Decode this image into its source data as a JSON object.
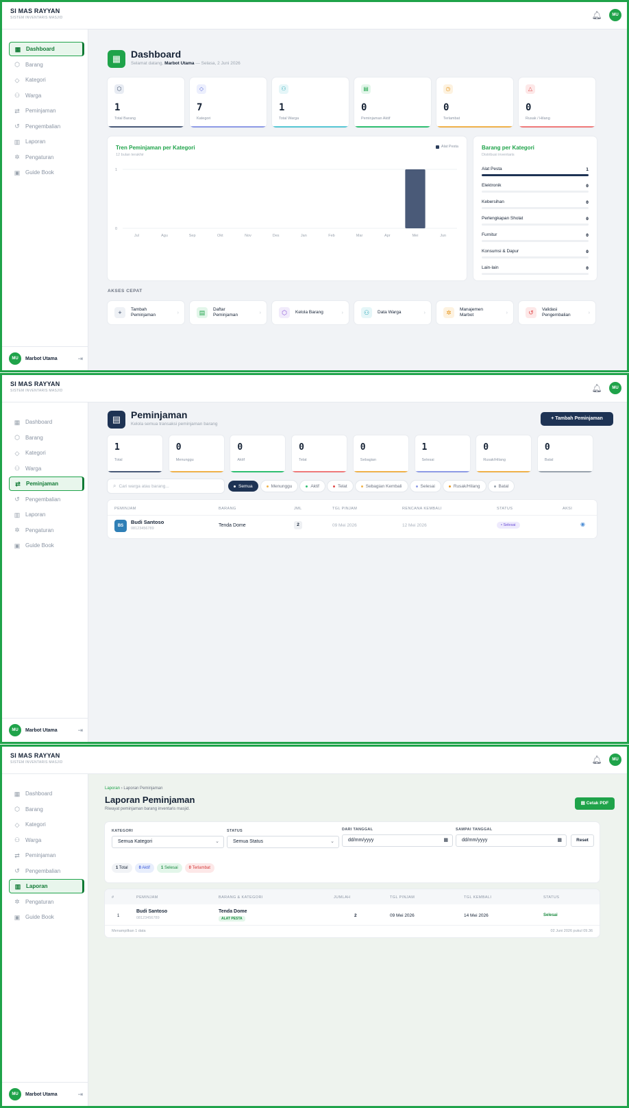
{
  "app": {
    "title": "SI MAS RAYYAN",
    "subtitle": "SISTEM INVENTARIS MASJID",
    "user_initials": "MU",
    "user_name": "Marbot Utama"
  },
  "sidebar": {
    "items": [
      {
        "label": "Dashboard",
        "icon": "grid-icon"
      },
      {
        "label": "Barang",
        "icon": "box-icon"
      },
      {
        "label": "Kategori",
        "icon": "tag-icon"
      },
      {
        "label": "Warga",
        "icon": "users-icon"
      },
      {
        "label": "Peminjaman",
        "icon": "swap-icon"
      },
      {
        "label": "Pengembalian",
        "icon": "undo-icon"
      },
      {
        "label": "Laporan",
        "icon": "chart-icon"
      },
      {
        "label": "Pengaturan",
        "icon": "gear-icon"
      },
      {
        "label": "Guide Book",
        "icon": "book-icon"
      }
    ]
  },
  "dashboard": {
    "title": "Dashboard",
    "greeting_prefix": "Selamat datang,",
    "greeting_name": "Marbot Utama",
    "greeting_suffix": "— Selasa, 2 Juni 2026",
    "stats": [
      {
        "value": "1",
        "label": "Total Barang",
        "color": "#4a5a78",
        "icon_bg": "#e8ecf3",
        "icon_color": "#2c3e5c"
      },
      {
        "value": "7",
        "label": "Kategori",
        "color": "#8e9be6",
        "icon_bg": "#eceffd",
        "icon_color": "#5a6bd8"
      },
      {
        "value": "1",
        "label": "Total Warga",
        "color": "#57c7d4",
        "icon_bg": "#e5f6f8",
        "icon_color": "#2fa9b8"
      },
      {
        "value": "0",
        "label": "Peminjaman Aktif",
        "color": "#2fbf71",
        "icon_bg": "#e3f6ea",
        "icon_color": "#1fa34a"
      },
      {
        "value": "0",
        "label": "Terlambat",
        "color": "#f0b24a",
        "icon_bg": "#fdf2e0",
        "icon_color": "#e7961d"
      },
      {
        "value": "0",
        "label": "Rusak / Hilang",
        "color": "#f07a7a",
        "icon_bg": "#fde8e8",
        "icon_color": "#e04a4a"
      }
    ],
    "trend_title": "Tren Peminjaman per Kategori",
    "trend_sub": "12 bulan terakhir",
    "category_title": "Barang per Kategori",
    "category_sub": "Distribusi inventaris",
    "categories": [
      {
        "name": "Alat Pesta",
        "value": "1",
        "fill": 1
      },
      {
        "name": "Elektronik",
        "value": "0",
        "fill": 0
      },
      {
        "name": "Kebersihan",
        "value": "0",
        "fill": 0
      },
      {
        "name": "Perlengkapan Sholat",
        "value": "0",
        "fill": 0
      },
      {
        "name": "Furnitur",
        "value": "0",
        "fill": 0
      },
      {
        "name": "Konsumsi & Dapur",
        "value": "0",
        "fill": 0
      },
      {
        "name": "Lain-lain",
        "value": "0",
        "fill": 0
      }
    ],
    "quick_title": "AKSES CEPAT",
    "quick": [
      {
        "line1": "Tambah",
        "line2": "Peminjaman",
        "icon": "plus-icon",
        "bg": "#eef1f5",
        "fg": "#2c3e5c",
        "glyph": "+"
      },
      {
        "line1": "Daftar",
        "line2": "Peminjaman",
        "icon": "clipboard-icon",
        "bg": "#e3f6ea",
        "fg": "#1fa34a",
        "glyph": "▤"
      },
      {
        "line1": "Kelola Barang",
        "line2": "",
        "icon": "box-icon",
        "bg": "#f1ebfb",
        "fg": "#8a56d8",
        "glyph": "⬡"
      },
      {
        "line1": "Data Warga",
        "line2": "",
        "icon": "users-icon",
        "bg": "#e5f6f8",
        "fg": "#2fa9b8",
        "glyph": "⚇"
      },
      {
        "line1": "Manajemen",
        "line2": "Marbot",
        "icon": "gear-icon",
        "bg": "#fdf2e0",
        "fg": "#e7961d",
        "glyph": "✲"
      },
      {
        "line1": "Validasi",
        "line2": "Pengembalian",
        "icon": "undo-icon",
        "bg": "#fde8e8",
        "fg": "#e04a4a",
        "glyph": "↺"
      }
    ]
  },
  "chart_data": {
    "type": "bar",
    "title": "Tren Peminjaman per Kategori",
    "subtitle": "12 bulan terakhir",
    "categories": [
      "Jul",
      "Agu",
      "Sep",
      "Okt",
      "Nov",
      "Des",
      "Jan",
      "Feb",
      "Mar",
      "Apr",
      "Mei",
      "Jun"
    ],
    "series": [
      {
        "name": "Alat Pesta",
        "values": [
          0,
          0,
          0,
          0,
          0,
          0,
          0,
          0,
          0,
          0,
          1,
          0
        ],
        "color": "#4a5a78"
      }
    ],
    "yticks": [
      "0",
      "1"
    ],
    "ylim": [
      0,
      1
    ],
    "legend": "top-right"
  },
  "peminjaman": {
    "title": "Peminjaman",
    "subtitle": "Kelola semua transaksi peminjaman barang",
    "add_button": "+  Tambah Peminjaman",
    "stats": [
      {
        "value": "1",
        "label": "Total",
        "color": "#4a5a78"
      },
      {
        "value": "0",
        "label": "Menunggu",
        "color": "#f0b24a"
      },
      {
        "value": "0",
        "label": "Aktif",
        "color": "#2fbf71"
      },
      {
        "value": "0",
        "label": "Telat",
        "color": "#f07a7a"
      },
      {
        "value": "0",
        "label": "Sebagian",
        "color": "#f0b24a"
      },
      {
        "value": "1",
        "label": "Selesai",
        "color": "#8e9be6"
      },
      {
        "value": "0",
        "label": "Rusak/Hilang",
        "color": "#f0b24a"
      },
      {
        "value": "0",
        "label": "Batal",
        "color": "#9aa3ae"
      }
    ],
    "search_placeholder": "Cari warga atau barang...",
    "filters": [
      {
        "label": "Semua",
        "dot": "#ffffff"
      },
      {
        "label": "Menunggu",
        "dot": "#f0b24a"
      },
      {
        "label": "Aktif",
        "dot": "#2fbf71"
      },
      {
        "label": "Telat",
        "dot": "#e04a4a"
      },
      {
        "label": "Sebagian Kembali",
        "dot": "#f0b24a"
      },
      {
        "label": "Selesai",
        "dot": "#8e9be6"
      },
      {
        "label": "Rusak/Hilang",
        "dot": "#e7961d"
      },
      {
        "label": "Batal",
        "dot": "#9aa3ae"
      }
    ],
    "columns": [
      "PEMINJAM",
      "BARANG",
      "JML",
      "TGL PINJAM",
      "RENCANA KEMBALI",
      "STATUS",
      "AKSI"
    ],
    "rows": [
      {
        "initials": "BS",
        "name": "Budi Santoso",
        "phone": "08123456789",
        "item": "Tenda Dome",
        "qty": "2",
        "pinjam": "09 Mei 2026",
        "kembali": "12 Mei 2026",
        "status": "• Selesai"
      }
    ]
  },
  "laporan": {
    "breadcrumb_root": "Laporan",
    "breadcrumb_sep": "›",
    "breadcrumb_current": "Laporan Peminjaman",
    "title": "Laporan Peminjaman",
    "subtitle": "Riwayat peminjaman barang inventaris masjid.",
    "print_button": "Cetak PDF",
    "filter_labels": {
      "kategori": "KATEGORI",
      "status": "STATUS",
      "dari": "DARI TANGGAL",
      "sampai": "SAMPAI TANGGAL"
    },
    "kategori_value": "Semua Kategori",
    "status_value": "Semua Status",
    "dari_value": "dd/mm/yyyy",
    "sampai_value": "dd/mm/yyyy",
    "reset": "Reset",
    "chips": [
      {
        "count": "1",
        "label": "Total",
        "bg": "#f1f3f6",
        "fg": "#152235"
      },
      {
        "count": "0",
        "label": "Aktif",
        "bg": "#e8eefc",
        "fg": "#3b5bdb"
      },
      {
        "count": "1",
        "label": "Selesai",
        "bg": "#e3f6ea",
        "fg": "#1a8a3f"
      },
      {
        "count": "0",
        "label": "Terlambat",
        "bg": "#fde8e8",
        "fg": "#d43b3b"
      }
    ],
    "columns": [
      "#",
      "PEMINJAM",
      "BARANG & KATEGORI",
      "JUMLAH",
      "TGL PINJAM",
      "TGL KEMBALI",
      "STATUS"
    ],
    "rows": [
      {
        "no": "1",
        "name": "Budi Santoso",
        "phone": "08123456789",
        "item": "Tenda Dome",
        "category": "ALAT PESTA",
        "qty": "2",
        "pinjam": "09 Mei 2026",
        "kembali": "14 Mei 2026",
        "status": "Selesai"
      }
    ],
    "footer_left": "Menampilkan 1 data",
    "footer_right": "02 Juni 2026 pukul 09.36"
  }
}
